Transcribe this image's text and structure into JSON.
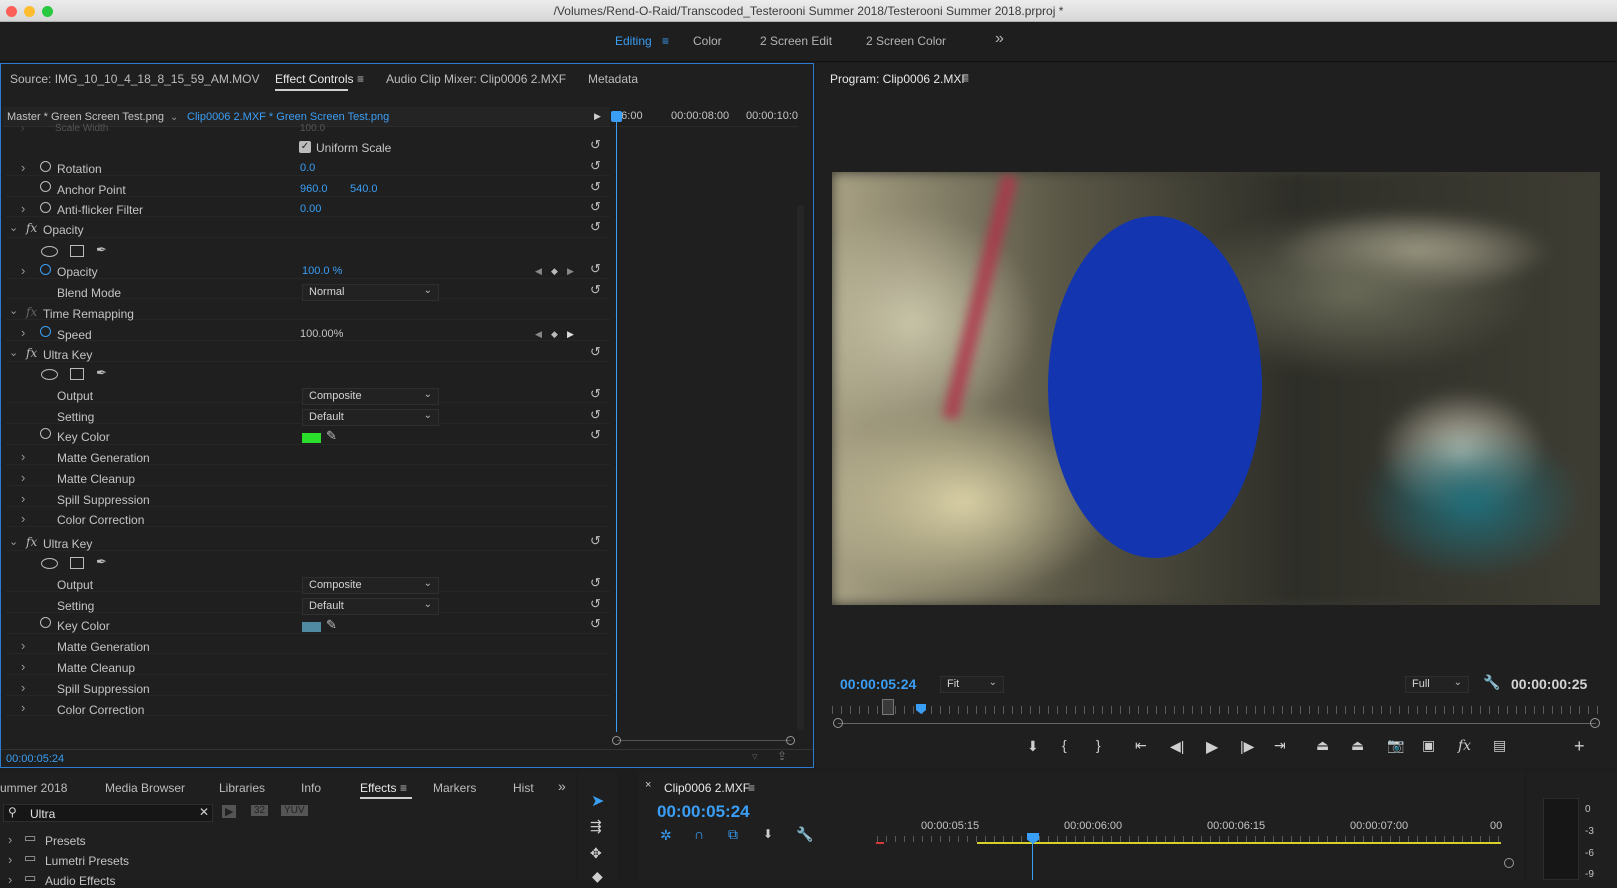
{
  "window": {
    "title": "/Volumes/Rend-O-Raid/Transcoded_Testerooni Summer 2018/Testerooni Summer 2018.prproj *"
  },
  "workspaces": {
    "editing": "Editing",
    "color": "Color",
    "screen_edit": "2 Screen Edit",
    "screen_color": "2 Screen Color",
    "more": "»"
  },
  "source_panel": {
    "tabs": [
      "Source: IMG_10_10_4_18_8_15_59_AM.MOV",
      "Effect Controls",
      "Audio Clip Mixer: Clip0006 2.MXF",
      "Metadata"
    ],
    "master": "Master * Green Screen Test.png",
    "clip": "Clip0006 2.MXF * Green Screen Test.png",
    "timecodes": [
      ":06:00",
      "00:00:08:00",
      "00:00:10:0"
    ],
    "scale_width_label": "Scale Width",
    "scale_width_value": "100.0",
    "uniform_scale": "Uniform Scale",
    "rotation": {
      "label": "Rotation",
      "value": "0.0"
    },
    "anchor": {
      "label": "Anchor Point",
      "x": "960.0",
      "y": "540.0"
    },
    "antiflicker": {
      "label": "Anti-flicker Filter",
      "value": "0.00"
    },
    "opacity_section": "Opacity",
    "opacity": {
      "label": "Opacity",
      "value": "100.0 %"
    },
    "blend_mode": {
      "label": "Blend Mode",
      "value": "Normal"
    },
    "time_remapping": "Time Remapping",
    "speed": {
      "label": "Speed",
      "value": "100.00%"
    },
    "ultra_key_1": {
      "title": "Ultra Key",
      "output_label": "Output",
      "output": "Composite",
      "setting_label": "Setting",
      "setting": "Default",
      "key_color_label": "Key Color",
      "key_color": "#2bde2b",
      "sub": [
        "Matte Generation",
        "Matte Cleanup",
        "Spill Suppression",
        "Color Correction"
      ]
    },
    "ultra_key_2": {
      "title": "Ultra Key",
      "output_label": "Output",
      "output": "Composite",
      "setting_label": "Setting",
      "setting": "Default",
      "key_color_label": "Key Color",
      "key_color": "#4f8aa2",
      "sub": [
        "Matte Generation",
        "Matte Cleanup",
        "Spill Suppression",
        "Color Correction"
      ]
    },
    "footer_timecode": "00:00:05:24"
  },
  "program": {
    "title": "Program: Clip0006 2.MXF",
    "timecode": "00:00:05:24",
    "fit": "Fit",
    "quality": "Full",
    "duration": "00:00:00:25"
  },
  "project_panel": {
    "tabs": [
      "ummer 2018",
      "Media Browser",
      "Libraries",
      "Info",
      "Effects",
      "Markers",
      "Hist"
    ],
    "active_tab": "Effects",
    "search_value": "Ultra",
    "items": [
      "Presets",
      "Lumetri Presets",
      "Audio Effects"
    ]
  },
  "timeline": {
    "clip": "Clip0006 2.MXF",
    "timecode": "00:00:05:24",
    "ruler": [
      "00:00:05:15",
      "00:00:06:00",
      "00:00:06:15",
      "00:00:07:00",
      "00"
    ]
  },
  "audio_meter": {
    "scale": [
      "0",
      "-3",
      "-6",
      "-9"
    ]
  },
  "colors": {
    "accent": "#3a9ef5",
    "matte": "#1336b0"
  }
}
